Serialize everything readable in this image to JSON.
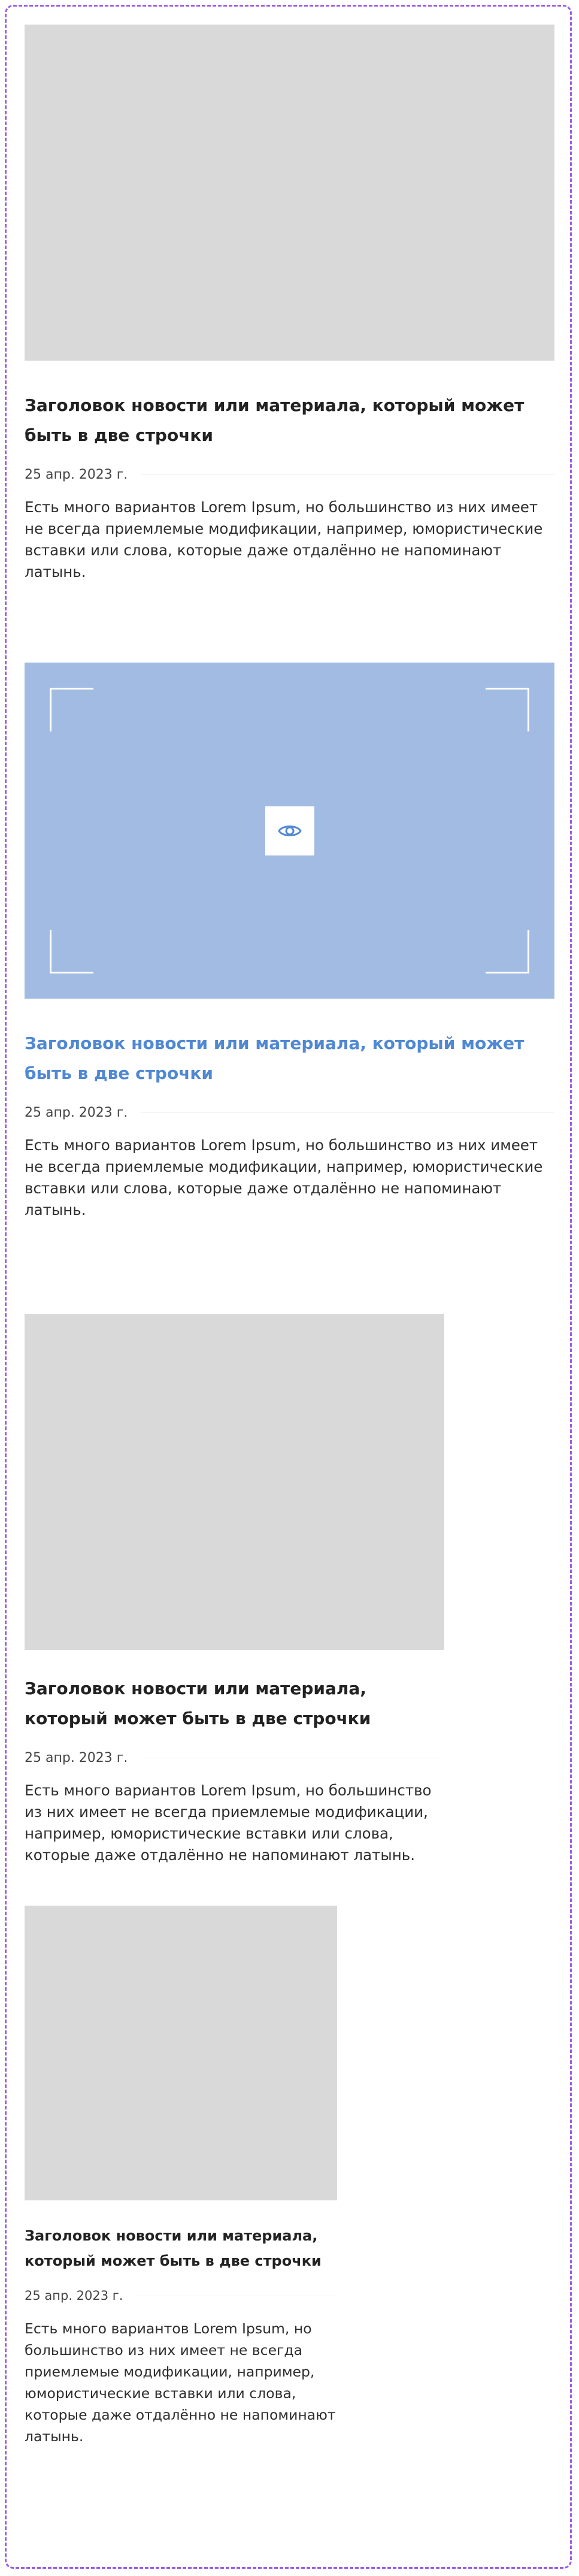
{
  "cards": [
    {
      "title": "Заголовок новости или материала, который может быть в две строчки",
      "date": "25 апр. 2023 г.",
      "text": "Есть много вариантов Lorem Ipsum, но большинство из них имеет не всегда приемлемые модификации, например, юмористические вставки или слова, которые даже отдалённо не напоминают латынь."
    },
    {
      "title": "Заголовок новости или материала, который может быть в две строчки",
      "date": "25 апр. 2023 г.",
      "text": "Есть много вариантов Lorem Ipsum, но большинство из них имеет не всегда приемлемые модификации, например, юмористические вставки или слова, которые даже отдалённо не напоминают латынь.",
      "icon": "eye-icon"
    },
    {
      "title": "Заголовок новости или материала, который может быть в две строчки",
      "date": "25 апр. 2023 г.",
      "text": "Есть много вариантов Lorem Ipsum, но большинство из них имеет не всегда приемлемые модификации, например, юмористические вставки или слова, которые даже отдалённо не напоминают латынь."
    },
    {
      "title": "Заголовок новости или материала, который может быть в две строчки",
      "date": "25 апр. 2023 г.",
      "text": "Есть много вариантов Lorem Ipsum, но большинство из них имеет не всегда приемлемые модификации, например, юмористические вставки или слова, которые даже отдалённо не напоминают латынь."
    }
  ],
  "colors": {
    "frame_border": "#9b5de5",
    "placeholder": "#d9d9d9",
    "hover_overlay": "#a2bbe2",
    "accent_title": "#5088d4"
  }
}
